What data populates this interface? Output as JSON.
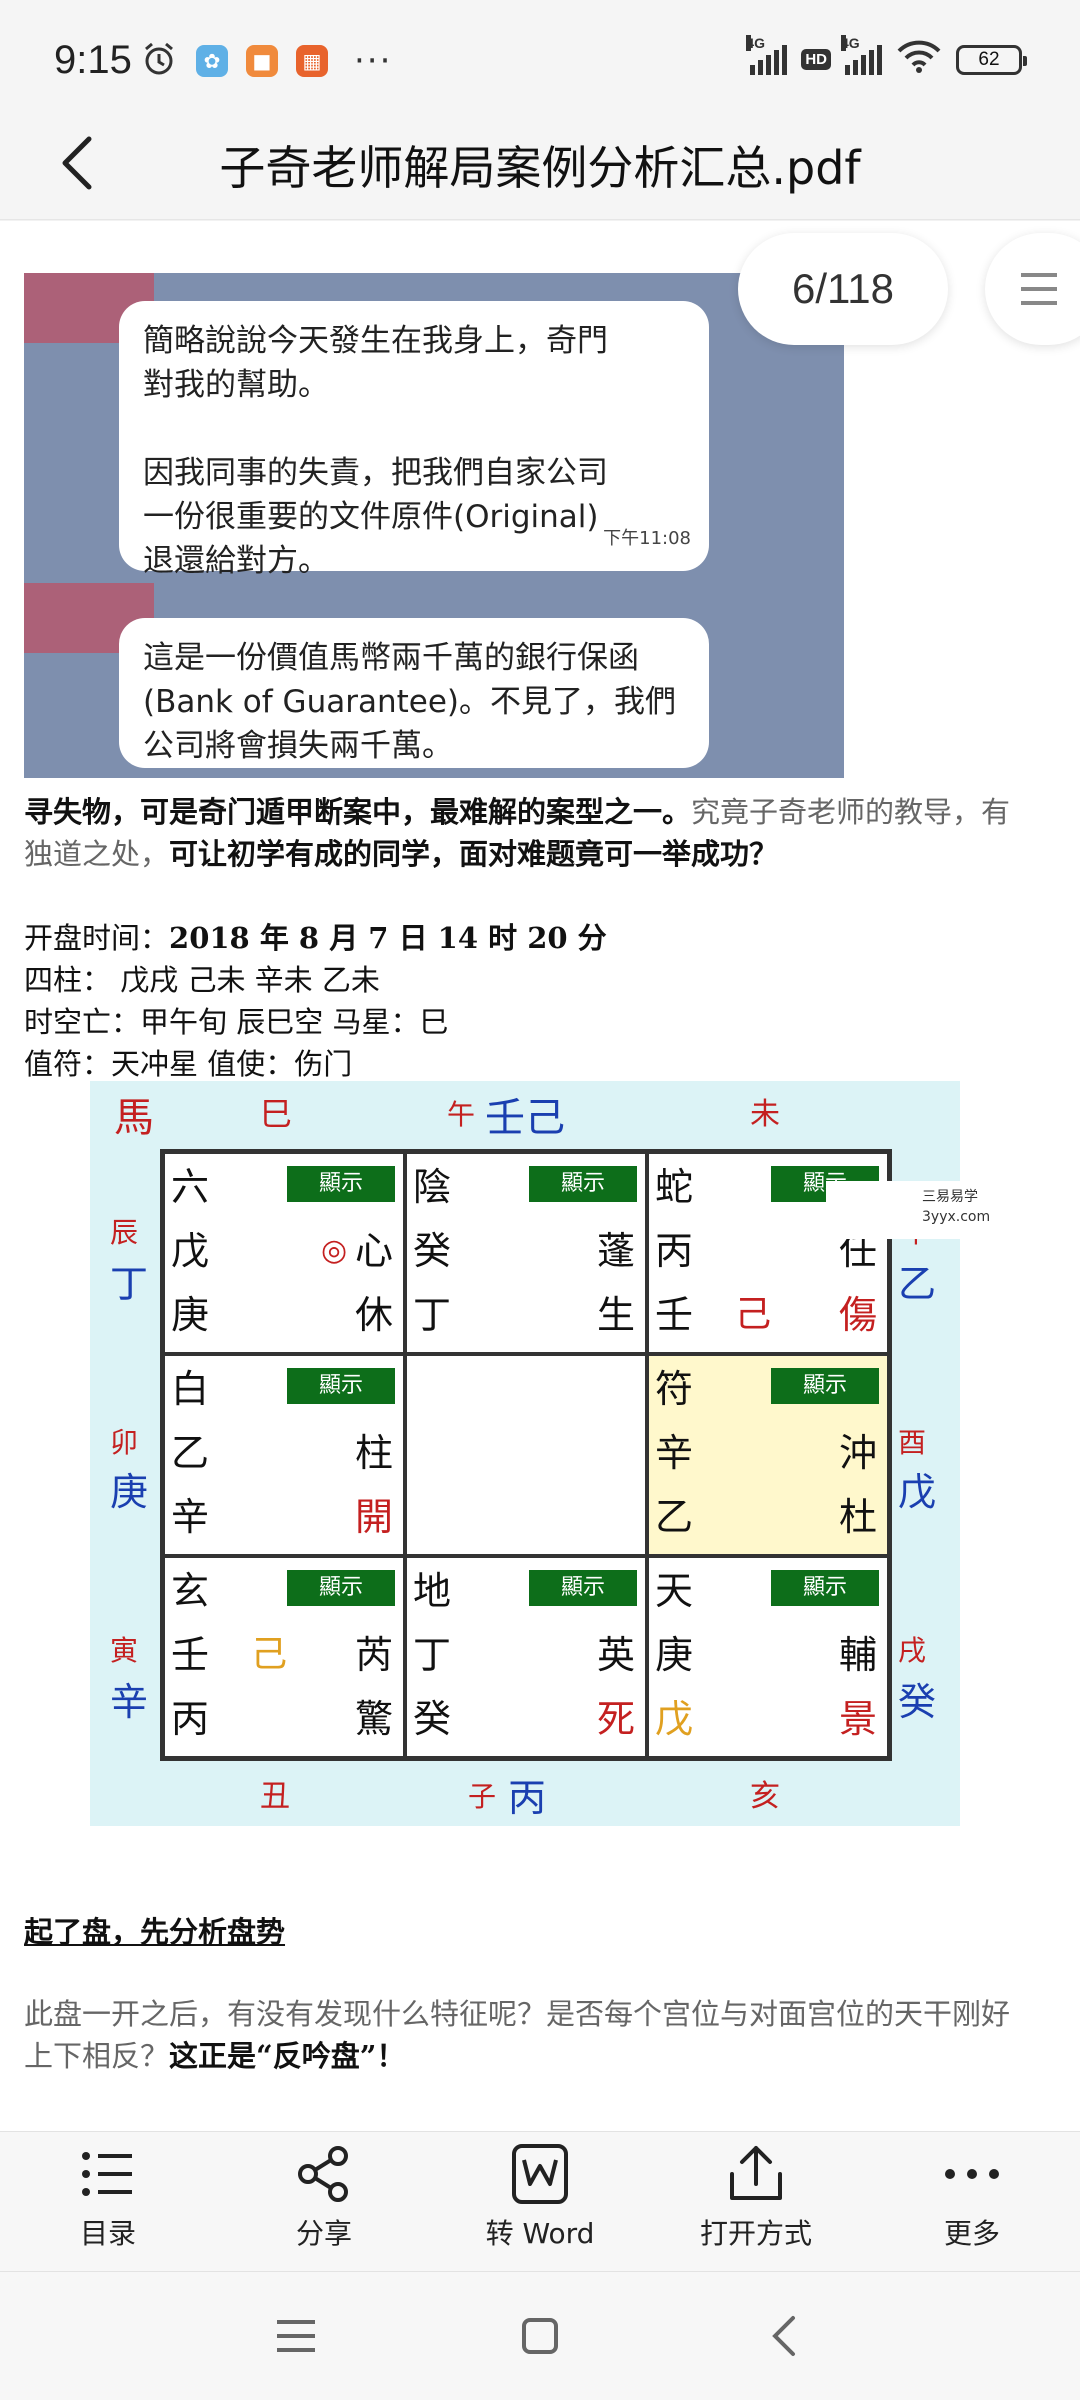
{
  "status_bar": {
    "time": "9:15",
    "network1": "4G",
    "network2": "4G",
    "hd": "HD",
    "battery": "62",
    "more": "···"
  },
  "header": {
    "title": "子奇老师解局案例分析汇总.pdf"
  },
  "viewer": {
    "page_counter": "6/118"
  },
  "chat": {
    "bubble1_lines": [
      "簡略說說今天發生在我身上，奇門",
      "對我的幫助。",
      "",
      "因我同事的失責，把我們自家公司",
      "一份很重要的文件原件(Original)",
      "退還給對方。"
    ],
    "bubble1_time": "下午11:08",
    "bubble2_lines": [
      "這是一份價值馬幣兩千萬的銀行保函",
      "(Bank of Guarantee)。不見了，我們",
      "公司將會損失兩千萬。"
    ]
  },
  "intro": {
    "line1_bold": "寻失物，可是奇门遁甲断案中，最难解的案型之一。",
    "line1_gray": "究竟子奇老师的教导，有",
    "line2_gray": "独道之处，",
    "line2_bold": "可让初学有成的同学，面对难题竟可一举成功？"
  },
  "chart_info": {
    "time_label": "开盘时间：",
    "time_value": "2018 年 8 月 7 日 14 时 20 分",
    "pillars_label": "四柱：",
    "pillars_value": " 戊戌  己未  辛未  乙未",
    "void_label": "时空亡：",
    "void_value": "甲午旬  辰巳空  马星：巳",
    "duty_label": "值符：",
    "duty_value": "天冲星  值使：伤门"
  },
  "board": {
    "top": [
      "馬",
      "巳",
      "午",
      "壬己",
      "未"
    ],
    "left": [
      "辰",
      "丁",
      "卯",
      "庚",
      "寅",
      "辛"
    ],
    "right": [
      "申",
      "乙",
      "酉",
      "戊",
      "戌",
      "癸"
    ],
    "bottom": [
      "丑",
      "子",
      "丙",
      "亥"
    ],
    "show_label": "顯示",
    "cells": [
      {
        "r1": "六",
        "r2": "戊",
        "r2_mid": "◎",
        "r2_right": "心",
        "r3": "庚",
        "r3_right": "休"
      },
      {
        "r1": "陰",
        "r2": "癸",
        "r2_right": "蓬",
        "r3": "丁",
        "r3_right": "生"
      },
      {
        "r1": "蛇",
        "r2": "丙",
        "r2_right": "任",
        "r3": "壬",
        "r3_mid": "己",
        "r3_right": "傷"
      },
      {
        "r1": "白",
        "r2": "乙",
        "r2_right": "柱",
        "r3": "辛",
        "r3_right": "開"
      },
      {
        "r1": "",
        "r2": "",
        "r3": ""
      },
      {
        "r1": "符",
        "r2": "辛",
        "r2_right": "沖",
        "r3": "乙",
        "r3_right": "杜"
      },
      {
        "r1": "玄",
        "r2": "壬",
        "r2_mid": "己",
        "r2_right": "芮",
        "r3": "丙",
        "r3_right": "驚"
      },
      {
        "r1": "地",
        "r2": "丁",
        "r2_right": "英",
        "r3": "癸",
        "r3_right": "死"
      },
      {
        "r1": "天",
        "r2": "庚",
        "r2_right": "輔",
        "r3": "戊",
        "r3_right": "景"
      }
    ]
  },
  "watermark": {
    "line1": "三易易学",
    "line2": "3yyx.com"
  },
  "analysis": {
    "heading": "起了盘，先分析盘势",
    "line1": "此盘一开之后，有没有发现什么特征呢？是否每个宫位与对面宫位的天干刚好",
    "line2_gray": "上下相反？",
    "line2_bold": "这正是“反吟盘”！"
  },
  "toolbar": {
    "items": [
      {
        "label": "目录",
        "icon": "list-icon"
      },
      {
        "label": "分享",
        "icon": "share-icon"
      },
      {
        "label": "转 Word",
        "icon": "word-icon"
      },
      {
        "label": "打开方式",
        "icon": "open-with-icon"
      },
      {
        "label": "更多",
        "icon": "more-icon"
      }
    ]
  }
}
